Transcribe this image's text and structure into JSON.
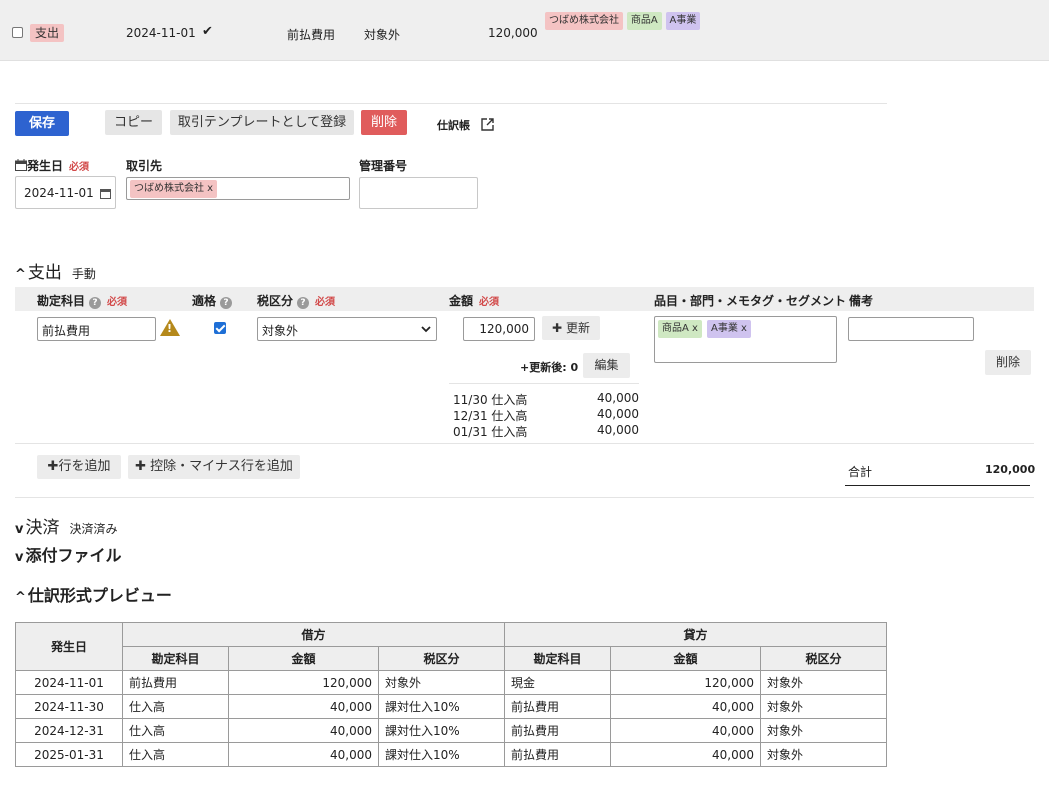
{
  "colors": {
    "accent": "#2e63d0",
    "danger": "#e05c5c",
    "required": "#d24a4a",
    "tag_partner": "#f4c3c3",
    "tag_item": "#cfe8c2",
    "tag_section": "#cfc3ef"
  },
  "top_row": {
    "type": "支出",
    "date": "2024-11-01",
    "account": "前払費用",
    "tax": "対象外",
    "amount": "120,000",
    "tags": [
      "つばめ株式会社",
      "商品A",
      "A事業"
    ]
  },
  "toolbar": {
    "save": "保存",
    "copy": "コピー",
    "template": "取引テンプレートとして登録",
    "delete": "削除",
    "journal": "仕訳帳"
  },
  "form": {
    "date_label": "発生日",
    "required": "必須",
    "date_value": "2024-11-01",
    "partner_label": "取引先",
    "partner_tag": "つばめ株式会社 x",
    "mgmt_label": "管理番号"
  },
  "expense": {
    "title": "支出",
    "mode": "手動",
    "headers": {
      "account": "勘定科目",
      "qualified": "適格",
      "tax": "税区分",
      "amount": "金額",
      "tags": "品目・部門・メモタグ・セグメント",
      "note": "備考"
    },
    "row": {
      "account": "前払費用",
      "tax": "対象外",
      "amount": "120,000",
      "update": "更新",
      "after_update": "+更新後: 0",
      "edit": "編集",
      "tags": [
        "商品A x",
        "A事業 x"
      ],
      "delete": "削除"
    },
    "schedule": [
      {
        "date": "11/30",
        "account": "仕入高",
        "amount": "40,000"
      },
      {
        "date": "12/31",
        "account": "仕入高",
        "amount": "40,000"
      },
      {
        "date": "01/31",
        "account": "仕入高",
        "amount": "40,000"
      }
    ],
    "add_row": "行を追加",
    "add_minus": "控除・マイナス行を追加",
    "total_label": "合計",
    "total_value": "120,000"
  },
  "settlement": {
    "title": "決済",
    "status": "決済済み"
  },
  "attachments": {
    "title": "添付ファイル"
  },
  "preview": {
    "title": "仕訳形式プレビュー",
    "date_header": "発生日",
    "debit": "借方",
    "credit": "貸方",
    "col_account": "勘定科目",
    "col_amount": "金額",
    "col_tax": "税区分",
    "rows": [
      {
        "date": "2024-11-01",
        "d_account": "前払費用",
        "d_amount": "120,000",
        "d_tax": "対象外",
        "c_account": "現金",
        "c_amount": "120,000",
        "c_tax": "対象外"
      },
      {
        "date": "2024-11-30",
        "d_account": "仕入高",
        "d_amount": "40,000",
        "d_tax": "課対仕入10%",
        "c_account": "前払費用",
        "c_amount": "40,000",
        "c_tax": "対象外"
      },
      {
        "date": "2024-12-31",
        "d_account": "仕入高",
        "d_amount": "40,000",
        "d_tax": "課対仕入10%",
        "c_account": "前払費用",
        "c_amount": "40,000",
        "c_tax": "対象外"
      },
      {
        "date": "2025-01-31",
        "d_account": "仕入高",
        "d_amount": "40,000",
        "d_tax": "課対仕入10%",
        "c_account": "前払費用",
        "c_amount": "40,000",
        "c_tax": "対象外"
      }
    ]
  }
}
